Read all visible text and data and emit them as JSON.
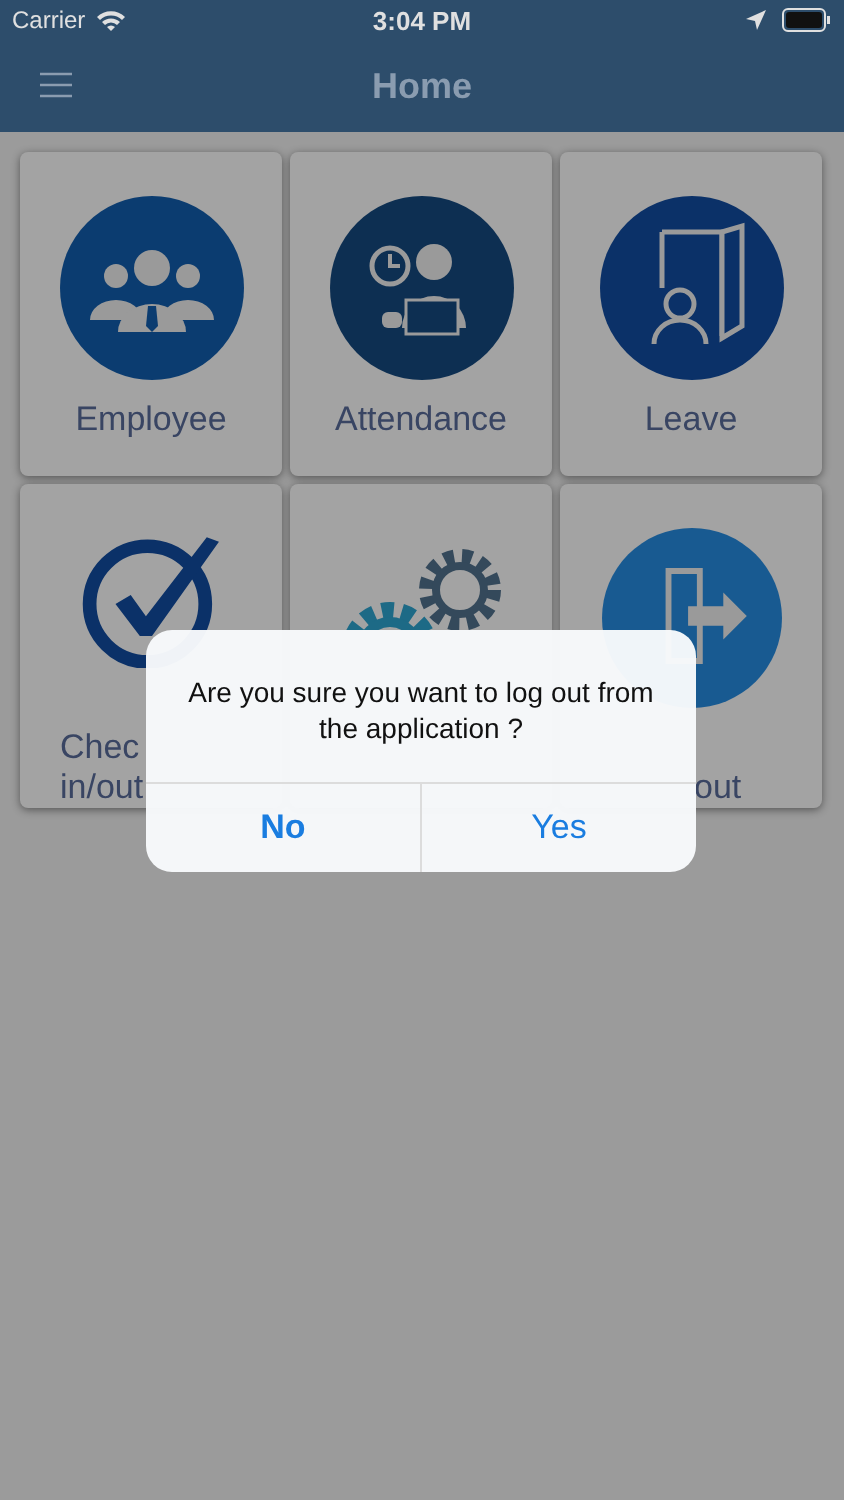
{
  "status_bar": {
    "carrier": "Carrier",
    "time": "3:04 PM"
  },
  "nav_bar": {
    "title": "Home"
  },
  "tiles": [
    {
      "kind": "team",
      "label_lines": [
        "Employee"
      ]
    },
    {
      "kind": "attendance",
      "label_lines": [
        "Attendance"
      ]
    },
    {
      "kind": "leave",
      "label_lines": [
        "Leave"
      ]
    },
    {
      "kind": "check",
      "label_lines": [
        "Chec",
        "in/out"
      ]
    },
    {
      "kind": "settings"
    },
    {
      "kind": "logout",
      "label_lines": [
        "out"
      ]
    }
  ],
  "dialog": {
    "message": "Are you sure you want to log out from the application ?",
    "buttons": [
      "No",
      "Yes"
    ]
  }
}
